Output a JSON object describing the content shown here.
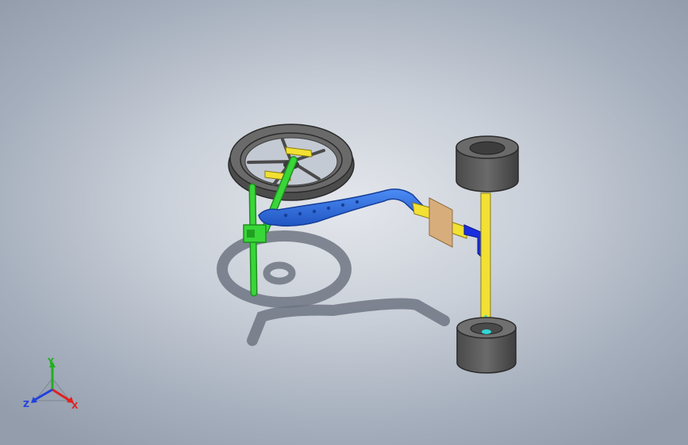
{
  "viewport": {
    "background_top": "#e4e7ec",
    "background_edge": "#939dac"
  },
  "model": {
    "colors": {
      "tire": "#5b5b5b",
      "tire_dark": "#3a3a3a",
      "steering_green": "#33cc33",
      "frame_blue": "#2a6be0",
      "axle_yellow": "#f2e033",
      "bracket_blue": "#1a2ee0",
      "plate_tan": "#d8ad7c",
      "hub_cyan": "#33d6d6",
      "shadow": "#6f7682"
    }
  },
  "triad": {
    "x_label": "X",
    "y_label": "Y",
    "z_label": "Z",
    "x_color": "#e02020",
    "y_color": "#20b020",
    "z_color": "#2040e0"
  }
}
